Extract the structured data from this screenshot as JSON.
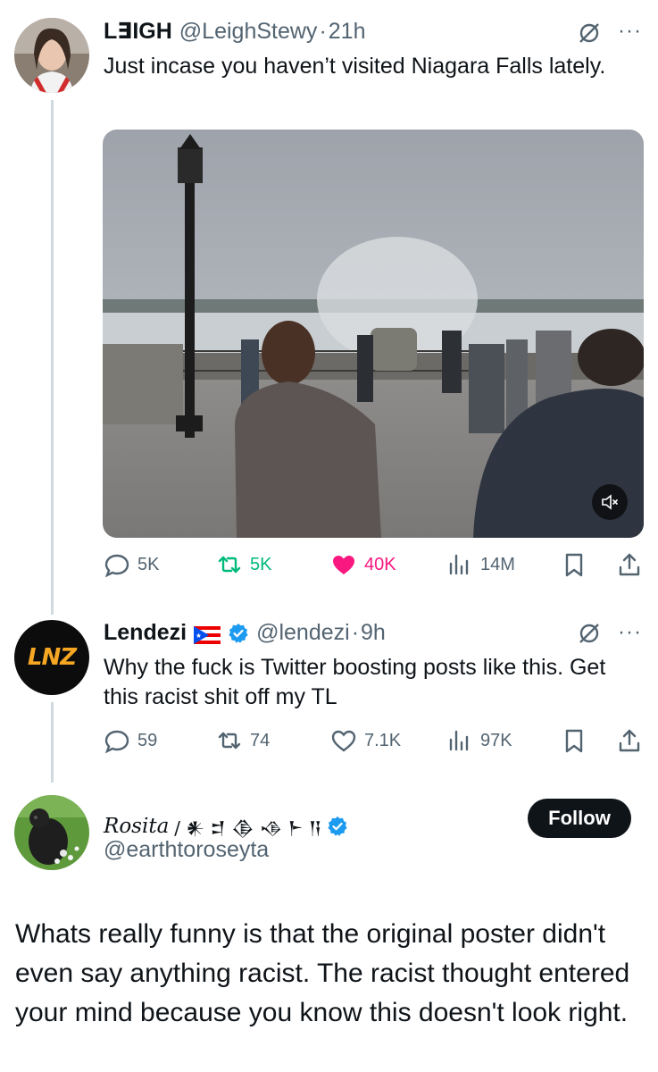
{
  "tweet1": {
    "display_name": "L∃IGH",
    "handle": "@LeighStewy",
    "separator": "·",
    "time": "21h",
    "text": "Just incase you haven’t visited Niagara Falls lately.",
    "actions": {
      "replies": "5K",
      "reposts": "5K",
      "likes": "40K",
      "views": "14M"
    },
    "media_icon": "mute-icon"
  },
  "tweet2": {
    "display_name": "Lendezi",
    "flag": "🇵🇷",
    "handle": "@lendezi",
    "separator": "·",
    "time": "9h",
    "avatar_text": "LNZ",
    "text": "Why the fuck is Twitter boosting posts like this. Get this racist shit off my TL",
    "actions": {
      "replies": "59",
      "reposts": "74",
      "likes": "7.1K",
      "views": "97K"
    }
  },
  "reply": {
    "display_name": "Rosita",
    "name_suffix": "/ 𒀭 𒄑 𒆠 𒈾 𒈨 𒀀",
    "handle": "@earthtoroseyta",
    "follow_label": "Follow",
    "text": "Whats really funny is that the original poster didn't even say anything racist. The racist thought entered your mind because you know this doesn't look right."
  },
  "colors": {
    "text_primary": "#0f1419",
    "text_secondary": "#536471",
    "repost_green": "#00ba7c",
    "like_pink": "#f91880",
    "verified_blue": "#1d9bf0",
    "thread_line": "#cfd9de"
  }
}
